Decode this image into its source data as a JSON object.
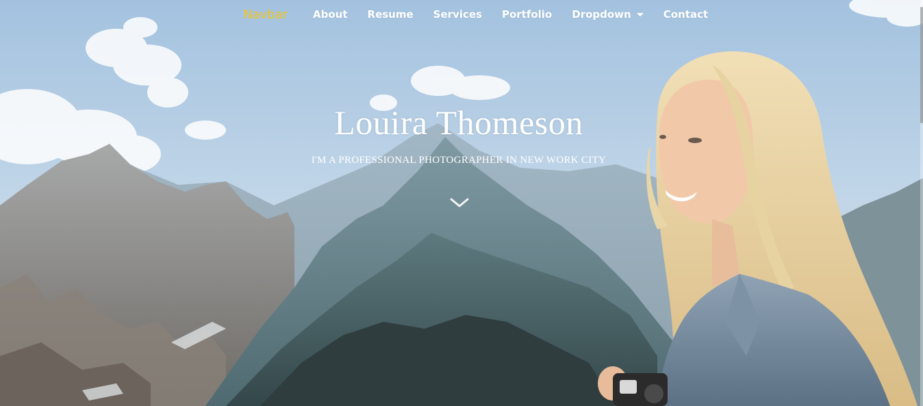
{
  "navbar": {
    "brand": "Navbar",
    "links": [
      {
        "label": "About"
      },
      {
        "label": "Resume"
      },
      {
        "label": "Services"
      },
      {
        "label": "Portfolio"
      },
      {
        "label": "Dropdown"
      },
      {
        "label": "Contact"
      }
    ]
  },
  "hero": {
    "title": "Louira Thomeson",
    "subtitle": "I'M A PROFESSIONAL PHOTOGRAPHER IN NEW WORK CITY",
    "scroll_icon": "chevron-down-icon"
  },
  "colors": {
    "brand": "#f5c518",
    "text": "#ffffff",
    "sky": "#b4cde4"
  }
}
